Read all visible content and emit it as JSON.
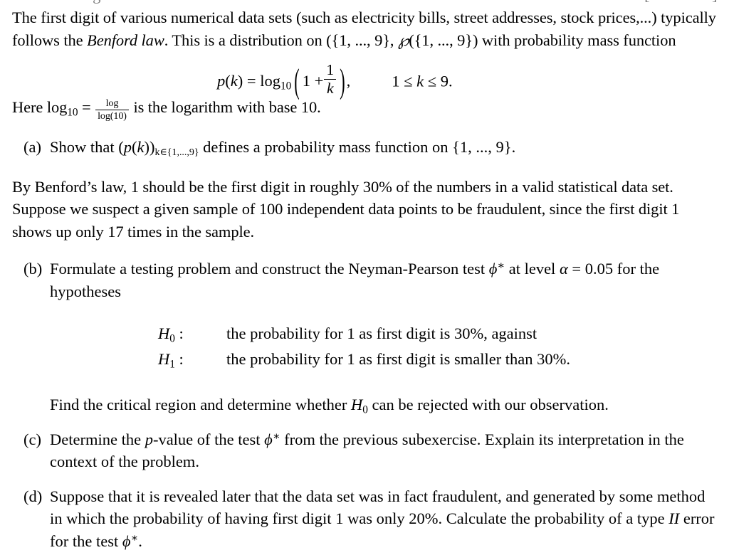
{
  "document": {
    "intro": {
      "sentence1_part1": "The first digit of various numerical data sets (such as electricity bills, street addresses, stock prices,...) typically follows the ",
      "benford_law_emph": "Benford law",
      "sentence1_part2": ". This is a distribution on (",
      "set_notation": "{1, ..., 9}",
      "sentence1_part3": ", ",
      "powerset_symbol": "℘",
      "sentence1_part4": " with probability mass function"
    },
    "formula": {
      "lhs_p": "p",
      "lhs_arg": "(k)",
      "equals": "=",
      "log_op": "log",
      "log_base": "10",
      "one_plus": "1 +",
      "frac_num": "1",
      "frac_den": "k",
      "comma": ",",
      "condition": "1 ≤ k ≤ 9."
    },
    "log_note": {
      "prefix": "Here log",
      "base": "10",
      "equals": "=",
      "frac_num": "log",
      "frac_den": "log(10)",
      "suffix": "is the logarithm with base 10."
    },
    "items": [
      {
        "label": "(a)",
        "text_part1": "Show that ",
        "math_pk": "(p(k))",
        "math_sub": "k∈{1,...,9}",
        "text_part2": " defines a probability mass function on ",
        "math_set": "{1, ..., 9}",
        "text_part3": "."
      },
      {
        "label": "(b)",
        "text_part1": "Formulate a testing problem and construct the Neyman-Pearson test ",
        "math_phi": "ϕ",
        "math_star": "∗",
        "text_part2": " at level ",
        "math_alpha": "α",
        "math_eq": "=",
        "math_alpha_value": "0.05",
        "text_part3": " for the hypotheses"
      },
      {
        "label": "(c)",
        "text_part1": "Determine the ",
        "math_p": "p",
        "text_part2": "-value of the test ",
        "math_phi": "ϕ",
        "math_star": "∗",
        "text_part3": " from the previous subexercise. Explain its interpretation in the context of the problem."
      },
      {
        "label": "(d)",
        "text_part1": "Suppose that it is revealed later that the data set was in fact fraudulent, and generated by some method in which the probability of having first digit 1 was only 20%. Calculate the probability of a type ",
        "math_II": "II",
        "text_part2": " error for the test ",
        "math_phi": "ϕ",
        "math_star": "∗",
        "text_part3": "."
      }
    ],
    "benford_paragraph": "By Benford’s law, 1 should be the first digit in roughly 30% of the numbers in a valid statistical data set. Suppose we suspect a given sample of 100 independent data points to be fraudulent, since the first digit 1 shows up only 17 times in the sample.",
    "hypotheses": [
      {
        "name_base": "H",
        "name_sub": "0",
        "colon": ":",
        "statement": "the probability for 1 as first digit is 30%, against"
      },
      {
        "name_base": "H",
        "name_sub": "1",
        "colon": ":",
        "statement": "the probability for 1 as first digit is smaller than 30%."
      }
    ],
    "find_line": {
      "part1": "Find the critical region and determine whether ",
      "math_H": "H",
      "math_H_sub": "0",
      "part2": " can be rejected with our observation."
    },
    "colors": {
      "text": "#000000",
      "background": "#ffffff"
    }
  }
}
